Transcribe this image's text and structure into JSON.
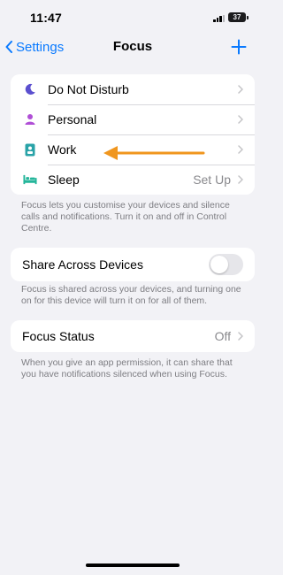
{
  "status_bar": {
    "time": "11:47",
    "battery": "37"
  },
  "nav": {
    "back_label": "Settings",
    "title": "Focus"
  },
  "focus_modes": [
    {
      "label": "Do Not Disturb",
      "value": "",
      "icon": "moon-icon",
      "color": "#5b4fcf"
    },
    {
      "label": "Personal",
      "value": "",
      "icon": "person-icon",
      "color": "#b04fd6"
    },
    {
      "label": "Work",
      "value": "",
      "icon": "id-badge-icon",
      "color": "#2aa3a8"
    },
    {
      "label": "Sleep",
      "value": "Set Up",
      "icon": "bed-icon",
      "color": "#24b59a"
    }
  ],
  "focus_footnote": "Focus lets you customise your devices and silence calls and notifications. Turn it on and off in Control Centre.",
  "share_across_devices": {
    "label": "Share Across Devices",
    "enabled": false,
    "footnote": "Focus is shared across your devices, and turning one on for this device will turn it on for all of them."
  },
  "focus_status": {
    "label": "Focus Status",
    "value": "Off",
    "footnote": "When you give an app permission, it can share that you have notifications silenced when using Focus."
  },
  "colors": {
    "accent": "#0a7aff",
    "annotation_arrow": "#f0961e"
  }
}
